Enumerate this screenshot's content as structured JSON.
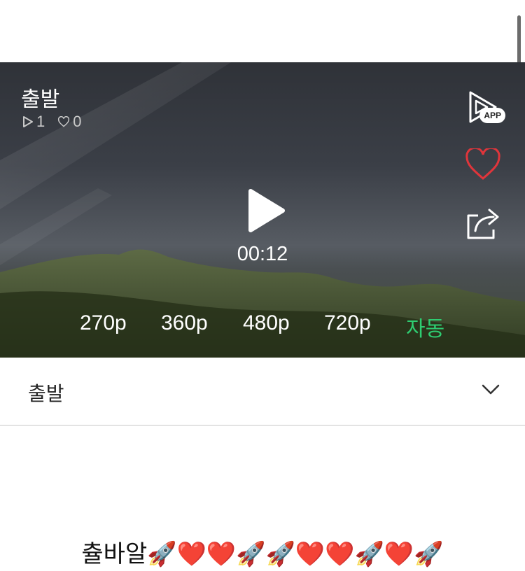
{
  "video": {
    "title": "출발",
    "play_count": "1",
    "like_count": "0",
    "duration": "00:12"
  },
  "actions": {
    "app_badge": "APP"
  },
  "quality": {
    "options": [
      "270p",
      "360p",
      "480p",
      "720p",
      "자동"
    ],
    "selected": "자동",
    "accent_color": "#2ecc71"
  },
  "info": {
    "title": "출발"
  },
  "description": "츌바알🚀❤️❤️🚀🚀❤️❤️🚀❤️🚀",
  "colors": {
    "like_heart": "#e0353b"
  }
}
